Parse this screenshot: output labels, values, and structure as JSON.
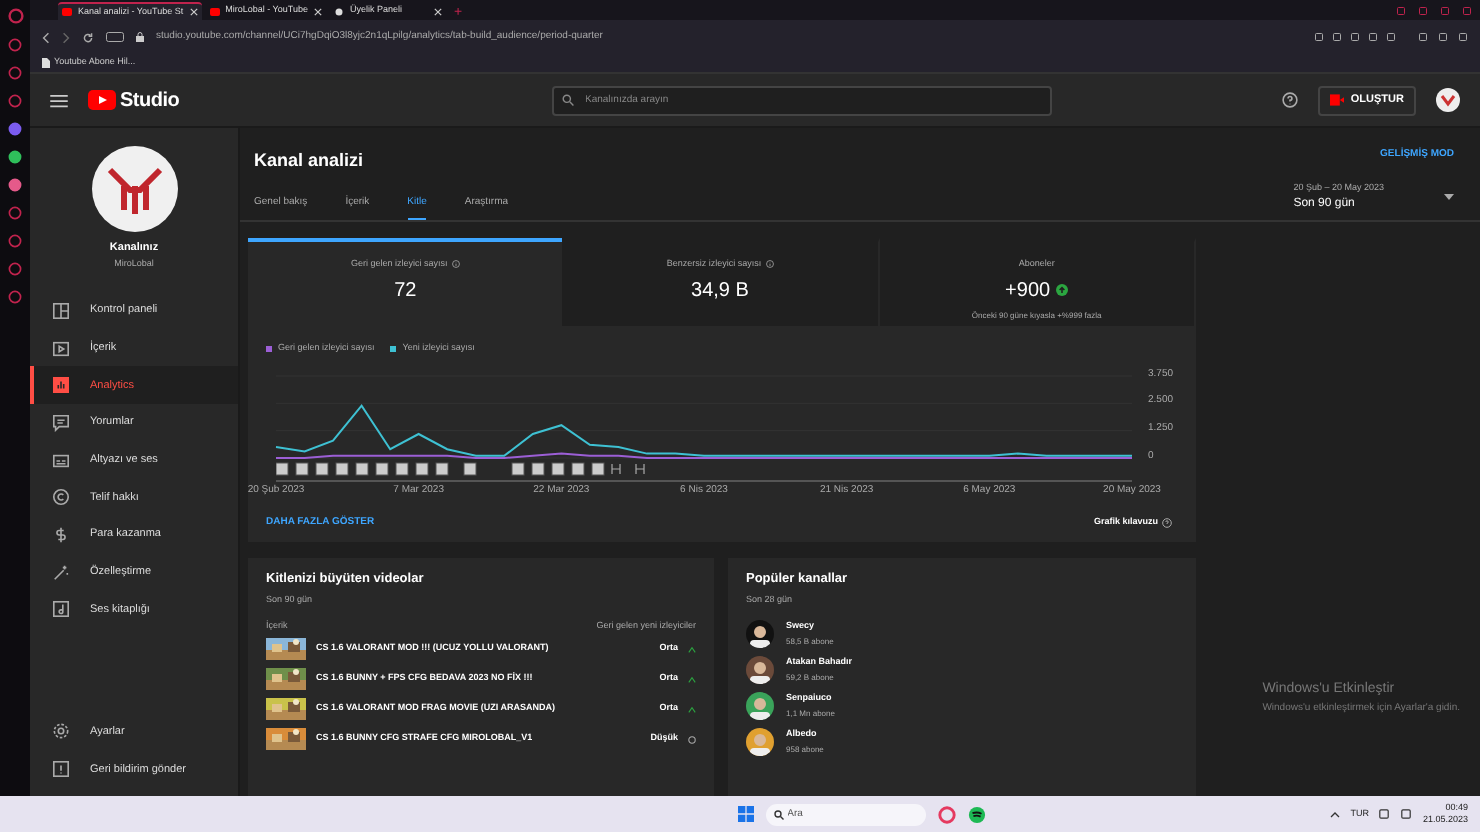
{
  "browser": {
    "tabs": [
      {
        "title": "Kanal analizi - YouTube St",
        "selected": true
      },
      {
        "title": "MiroLobal - YouTube",
        "selected": false
      },
      {
        "title": "Üyelik Paneli",
        "selected": false
      }
    ],
    "new_tab": "+",
    "url": "studio.youtube.com/channel/UCi7hgDqiO3l8yjc2n1qLpilg/analytics/tab-build_audience/period-quarter",
    "bookmarks": [
      "Youtube Abone Hil..."
    ]
  },
  "header": {
    "logo": "Studio",
    "search": {
      "placeholder": "Kanalınızda arayın"
    },
    "create": "OLUŞTUR"
  },
  "sidebar": {
    "channel_name": "Kanalınız",
    "channel_handle": "MiroLobal",
    "items": [
      {
        "label": "Kontrol paneli",
        "selected": false
      },
      {
        "label": "İçerik",
        "selected": false
      },
      {
        "label": "Analytics",
        "selected": true
      },
      {
        "label": "Yorumlar",
        "selected": false
      },
      {
        "label": "Altyazı ve ses",
        "selected": false
      },
      {
        "label": "Telif hakkı",
        "selected": false
      },
      {
        "label": "Para kazanma",
        "selected": false
      },
      {
        "label": "Özelleştirme",
        "selected": false
      },
      {
        "label": "Ses kitaplığı",
        "selected": false
      }
    ],
    "bottom_items": [
      {
        "label": "Ayarlar"
      },
      {
        "label": "Geri bildirim gönder"
      }
    ]
  },
  "page": {
    "title": "Kanal analizi",
    "advanced_mode": "GELİŞMİŞ MOD",
    "tabs": [
      {
        "label": "Genel bakış",
        "selected": false
      },
      {
        "label": "İçerik",
        "selected": false
      },
      {
        "label": "Kitle",
        "selected": true
      },
      {
        "label": "Araştırma",
        "selected": false
      }
    ],
    "date_range": "20 Şub – 20 May 2023",
    "period": "Son 90 gün"
  },
  "metrics": [
    {
      "label": "Geri gelen izleyici sayısı",
      "value": "72",
      "info": true,
      "selected": true
    },
    {
      "label": "Benzersiz izleyici sayısı",
      "value": "34,9 B",
      "info": true,
      "selected": false
    },
    {
      "label": "Aboneler",
      "value": "+900",
      "info": false,
      "selected": false,
      "note": "Önceki 90 güne kıyasla +%999 fazla"
    }
  ],
  "chart": {
    "chart_data": {
      "type": "line",
      "categories": [
        "20 Şub 2023",
        null,
        null,
        null,
        null,
        "7 Mar 2023",
        null,
        null,
        null,
        null,
        "22 Mar 2023",
        null,
        null,
        null,
        null,
        "6 Nis 2023",
        null,
        null,
        null,
        null,
        "21 Nis 2023",
        null,
        null,
        null,
        null,
        "6 May 2023",
        null,
        null,
        null,
        null,
        "20 May 2023"
      ],
      "series": [
        {
          "name": "Geri gelen izleyici sayısı",
          "color": "#9c5fd6",
          "values": [
            0,
            0,
            0.1,
            0.1,
            0.1,
            0.1,
            0.1,
            0,
            0,
            0.1,
            0.2,
            0.1,
            0.1,
            0,
            0,
            0,
            0,
            0,
            0,
            0,
            0,
            0,
            0,
            0,
            0,
            0,
            0,
            0,
            0,
            0,
            0
          ]
        },
        {
          "name": "Yeni izleyici sayısı",
          "color": "#3ec1d3",
          "values": [
            0.5,
            0.3,
            0.8,
            2.4,
            0.4,
            1.1,
            0.4,
            0.1,
            0.1,
            1.1,
            1.5,
            0.6,
            0.5,
            0.2,
            0.2,
            0.1,
            0.1,
            0.1,
            0.1,
            0.1,
            0.1,
            0.1,
            0.1,
            0.1,
            0.1,
            0.1,
            0.2,
            0.1,
            0.1,
            0.1,
            0.1
          ]
        }
      ],
      "ylim": [
        0,
        3.75
      ],
      "yticks": [
        0,
        {
          "value": 1.25,
          "label": "1.250"
        },
        {
          "value": 2.5,
          "label": "2.500"
        },
        {
          "value": 3.75,
          "label": "3.750"
        }
      ]
    },
    "more": "DAHA FAZLA GÖSTER",
    "guide": "Grafik kılavuzu"
  },
  "videos_card": {
    "title": "Kitlenizi büyüten videolar",
    "subtitle": "Son 90 gün",
    "columns": [
      "İçerik",
      "Geri gelen yeni izleyiciler"
    ],
    "rows": [
      {
        "title": "CS 1.6 VALORANT MOD !!! (UCUZ YOLLU VALORANT)",
        "rating": "Orta",
        "kind": "medium"
      },
      {
        "title": "CS 1.6 BUNNY + FPS CFG BEDAVA 2023 NO FİX !!!",
        "rating": "Orta",
        "kind": "medium"
      },
      {
        "title": "CS 1.6 VALORANT MOD FRAG MOVIE (UZI ARASANDA)",
        "rating": "Orta",
        "kind": "medium"
      },
      {
        "title": "CS 1.6 BUNNY CFG STRAFE CFG MIROLOBAL_V1",
        "rating": "Düşük",
        "kind": "low"
      }
    ]
  },
  "channels_card": {
    "title": "Popüler kanallar",
    "subtitle": "Son 28 gün",
    "channels": [
      {
        "name": "Swecy",
        "subs": "58,5 B abone"
      },
      {
        "name": "Atakan Bahadır",
        "subs": "59,2 B abone"
      },
      {
        "name": "Senpaiuco",
        "subs": "1,1 Mn abone"
      },
      {
        "name": "Albedo",
        "subs": "958 abone"
      }
    ]
  },
  "activation": {
    "title": "Windows'u Etkinleştir",
    "text": "Windows'u etkinleştirmek için Ayarlar'a gidin."
  },
  "taskbar": {
    "search": {
      "placeholder": "Ara"
    },
    "language": "TUR",
    "time": "00:49",
    "date": "21.05.2023"
  }
}
